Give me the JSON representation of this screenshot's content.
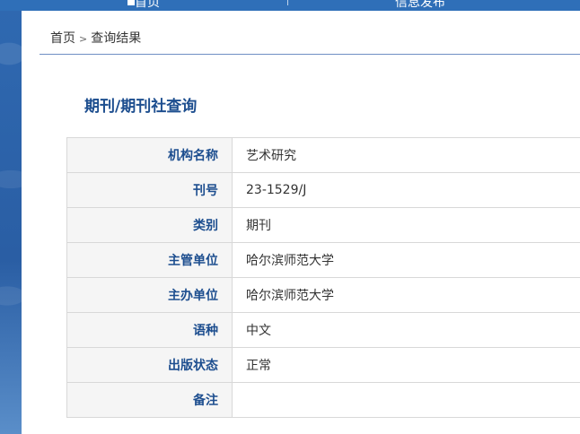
{
  "nav": {
    "home_label": "首页",
    "info_label": "信息发布"
  },
  "breadcrumb": {
    "home": "首页",
    "separator": ">",
    "current": "查询结果"
  },
  "page_title": "期刊/期刊社查询",
  "rows": [
    {
      "label": "机构名称",
      "value": "艺术研究"
    },
    {
      "label": "刊号",
      "value": "23-1529/J"
    },
    {
      "label": "类别",
      "value": "期刊"
    },
    {
      "label": "主管单位",
      "value": "哈尔滨师范大学"
    },
    {
      "label": "主办单位",
      "value": "哈尔滨师范大学"
    },
    {
      "label": "语种",
      "value": "中文"
    },
    {
      "label": "出版状态",
      "value": "正常"
    },
    {
      "label": "备注",
      "value": ""
    }
  ],
  "colors": {
    "brand_blue": "#2a62a8",
    "label_text": "#1d4e8f",
    "rule": "#6f8fc4"
  }
}
